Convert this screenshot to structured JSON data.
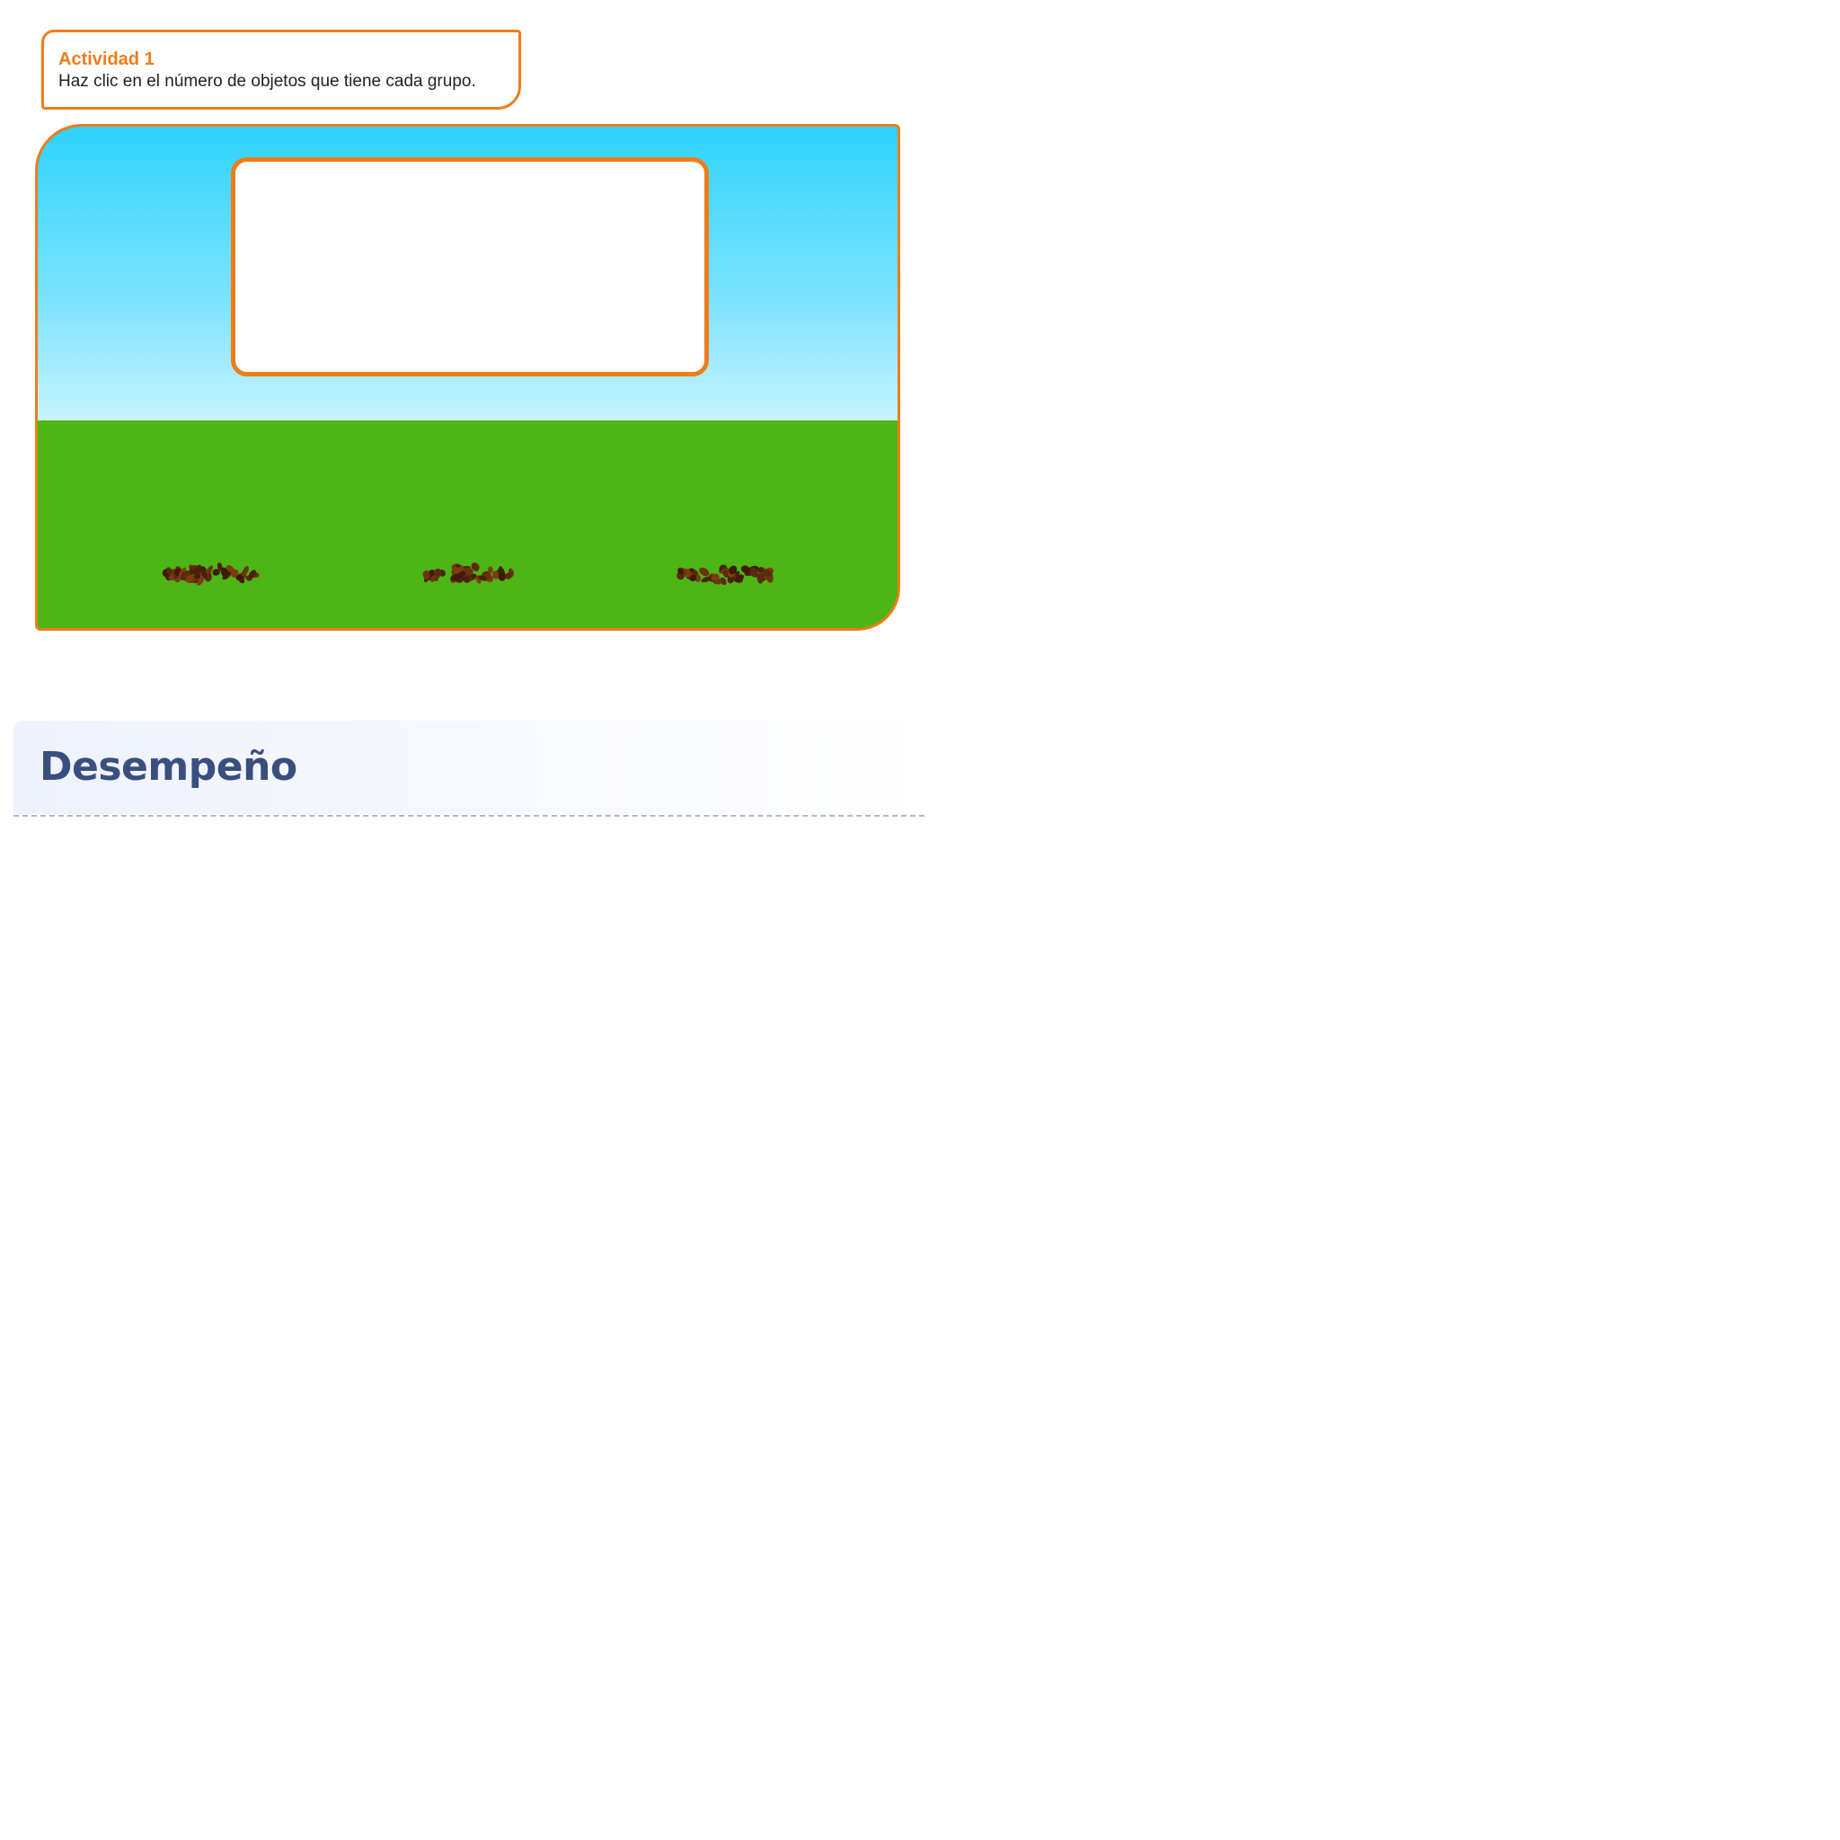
{
  "activity": {
    "title": "Actividad 1",
    "instruction": "Haz clic en el número de objetos que tiene cada grupo."
  },
  "stage": {
    "answer_panel_text": "",
    "groups": [
      {
        "name": "nest-group-1",
        "icon": "seed-pile-icon"
      },
      {
        "name": "nest-group-2",
        "icon": "seed-pile-icon"
      },
      {
        "name": "nest-group-3",
        "icon": "seed-pile-icon"
      }
    ],
    "colors": {
      "accent": "#f07c1a",
      "sky_top": "#2fd3fc",
      "sky_bottom": "#c7f3fe",
      "grass": "#4db515",
      "seeds": "#5a2a0c"
    }
  },
  "performance": {
    "title": "Desempeño"
  }
}
